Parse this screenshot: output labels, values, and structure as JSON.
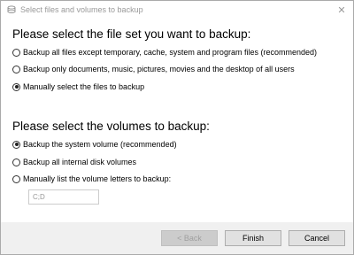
{
  "window": {
    "title": "Select files and volumes to backup",
    "close_glyph": "✕",
    "icon": "disk-icon"
  },
  "file_set": {
    "heading": "Please select the file set you want to backup:",
    "options": [
      {
        "label": "Backup all files except temporary, cache, system and program files (recommended)",
        "checked": false
      },
      {
        "label": "Backup only documents, music, pictures, movies and the desktop of all users",
        "checked": false
      },
      {
        "label": "Manually select the files to backup",
        "checked": true
      }
    ]
  },
  "volumes": {
    "heading": "Please select the volumes to backup:",
    "options": [
      {
        "label": "Backup the system volume (recommended)",
        "checked": true
      },
      {
        "label": "Backup all internal disk volumes",
        "checked": false
      },
      {
        "label": "Manually list the volume letters to backup:",
        "checked": false
      }
    ],
    "letters_value": "C;D"
  },
  "buttons": {
    "back": "< Back",
    "finish": "Finish",
    "cancel": "Cancel"
  }
}
